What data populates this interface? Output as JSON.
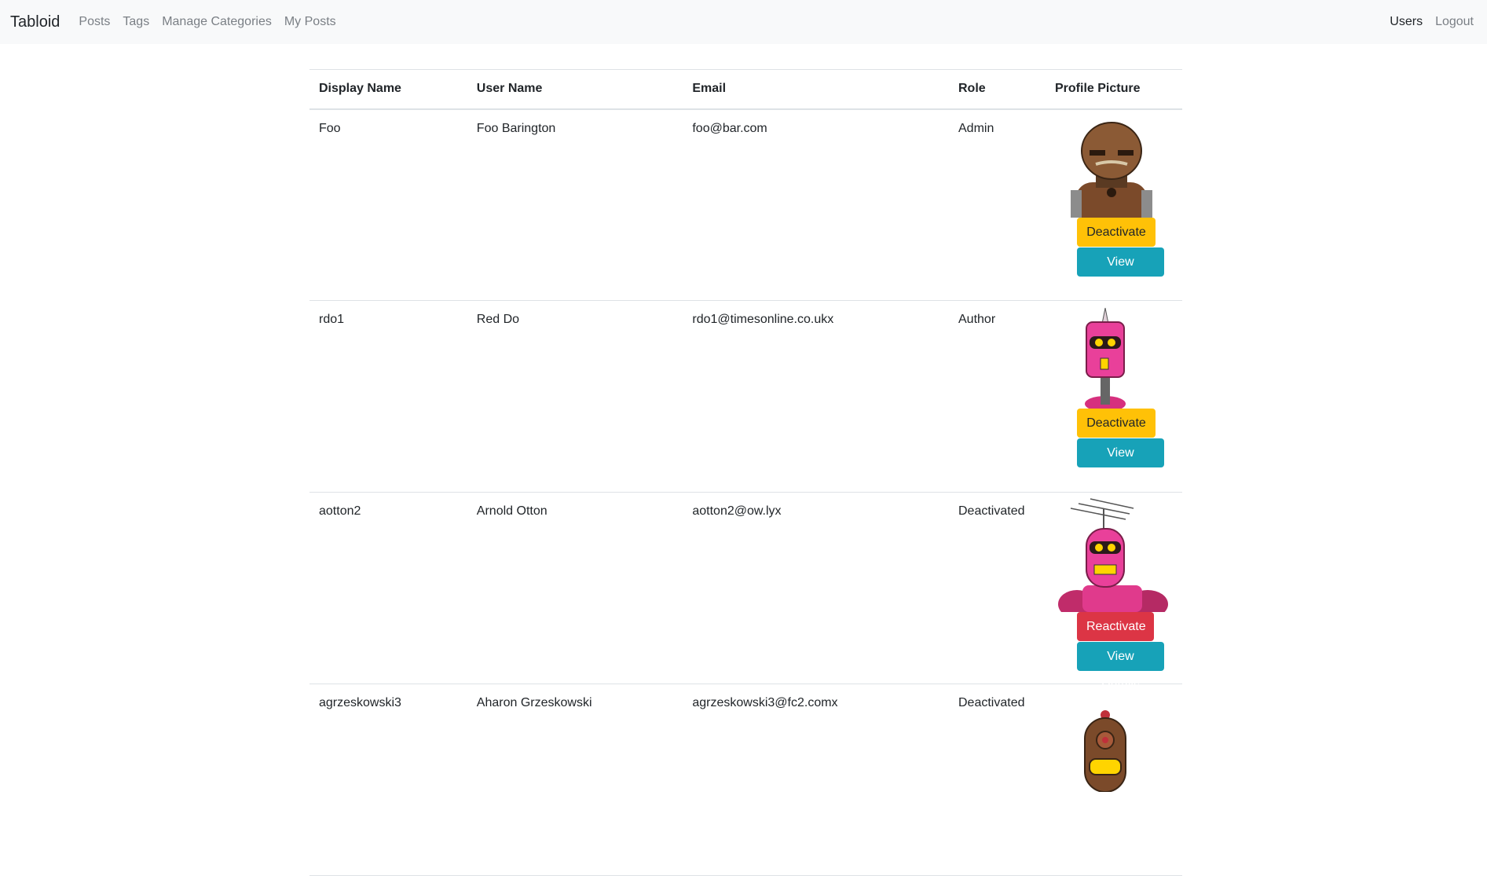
{
  "nav": {
    "brand": "Tabloid",
    "links": [
      "Posts",
      "Tags",
      "Manage Categories",
      "My Posts"
    ],
    "right": [
      "Users",
      "Logout"
    ]
  },
  "table": {
    "headers": [
      "Display Name",
      "User Name",
      "Email",
      "Role",
      "Profile Picture"
    ],
    "rows": [
      {
        "display": "Foo",
        "user": "Foo Barington",
        "email": "foo@bar.com",
        "role": "Admin",
        "action": "Deactivate",
        "details": "View Details",
        "avatar": "brown-robot"
      },
      {
        "display": "rdo1",
        "user": "Red Do",
        "email": "rdo1@timesonline.co.ukx",
        "role": "Author",
        "action": "Deactivate",
        "details": "View Details",
        "avatar": "pink-cylinder-robot"
      },
      {
        "display": "aotton2",
        "user": "Arnold Otton",
        "email": "aotton2@ow.lyx",
        "role": "Deactivated",
        "action": "Reactivate",
        "details": "View Details",
        "avatar": "pink-antenna-robot"
      },
      {
        "display": "agrzeskowski3",
        "user": "Aharon Grzeskowski",
        "email": "agrzeskowski3@fc2.comx",
        "role": "Deactivated",
        "action": "",
        "details": "",
        "avatar": "brown-cyclops-robot"
      }
    ]
  },
  "colors": {
    "warning": "#ffc107",
    "danger": "#dc3545",
    "info": "#17a2b8",
    "navbar": "#f8f9fa"
  }
}
